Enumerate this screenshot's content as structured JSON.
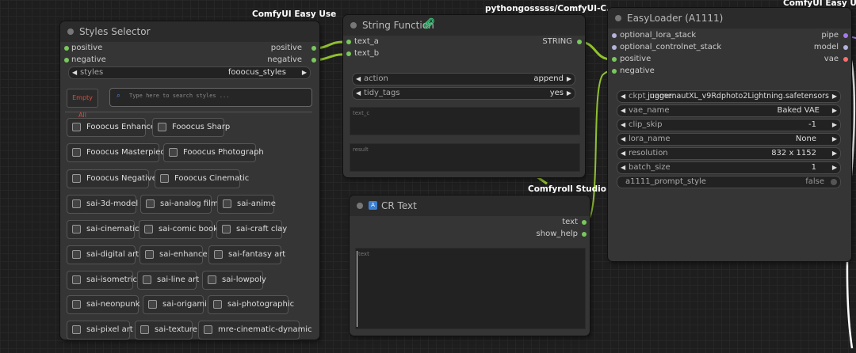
{
  "styles_selector": {
    "badge": "ComfyUI Easy Use",
    "title": "Styles Selector",
    "outputs": [
      "positive",
      "negative"
    ],
    "styles_widget": {
      "label": "styles",
      "value": "fooocus_styles"
    },
    "empty_all_label": "Empty All",
    "search_placeholder": "Type here to search styles ...",
    "style_items": [
      "Fooocus Enhance",
      "Fooocus Sharp",
      "Fooocus Masterpiece",
      "Fooocus Photograph",
      "Fooocus Negative",
      "Fooocus Cinematic",
      "sai-3d-model",
      "sai-analog film",
      "sai-anime",
      "sai-cinematic",
      "sai-comic book",
      "sai-craft clay",
      "sai-digital art",
      "sai-enhance",
      "sai-fantasy art",
      "sai-isometric",
      "sai-line art",
      "sai-lowpoly",
      "sai-neonpunk",
      "sai-origami",
      "sai-photographic",
      "sai-pixel art",
      "sai-texture",
      "mre-cinematic-dynamic"
    ]
  },
  "string_function": {
    "badge": "pythongosssss/ComfyUI-C...",
    "title": "String Function",
    "inputs": [
      "text_a",
      "text_b"
    ],
    "output": "STRING",
    "widgets": [
      {
        "label": "action",
        "value": "append"
      },
      {
        "label": "tidy_tags",
        "value": "yes"
      }
    ],
    "text_c_placeholder": "text_c",
    "result_placeholder": "result"
  },
  "cr_text": {
    "badge": "Comfyroll Studio",
    "title": "CR Text",
    "outputs": [
      "text",
      "show_help"
    ],
    "text_placeholder": "text"
  },
  "easy_loader": {
    "badge": "ComfyUI Easy Use",
    "title": "EasyLoader (A1111)",
    "inputs": [
      "optional_lora_stack",
      "optional_controlnet_stack",
      "positive",
      "negative"
    ],
    "outputs": [
      "pipe",
      "model",
      "vae"
    ],
    "widgets": [
      {
        "label": "ckpt_name",
        "value": "juggernautXL_v9Rdphoto2Lightning.safetensors"
      },
      {
        "label": "vae_name",
        "value": "Baked VAE"
      },
      {
        "label": "clip_skip",
        "value": "-1"
      },
      {
        "label": "lora_name",
        "value": "None"
      },
      {
        "label": "resolution",
        "value": "832 x 1152"
      },
      {
        "label": "batch_size",
        "value": "1"
      }
    ],
    "toggle": {
      "label": "a1111_prompt_style",
      "value": "false"
    }
  },
  "colors": {
    "conditioning": "#ffa931",
    "string": "#79c85c",
    "pipe": "#a57be8",
    "model": "#b3b3dd",
    "vae": "#ff6e6e",
    "wire": "#90c030",
    "empty_all": "#e04a3a"
  },
  "icons": {
    "cr_text": "text-icon",
    "string_function": "link-icon",
    "search": "search-icon"
  }
}
